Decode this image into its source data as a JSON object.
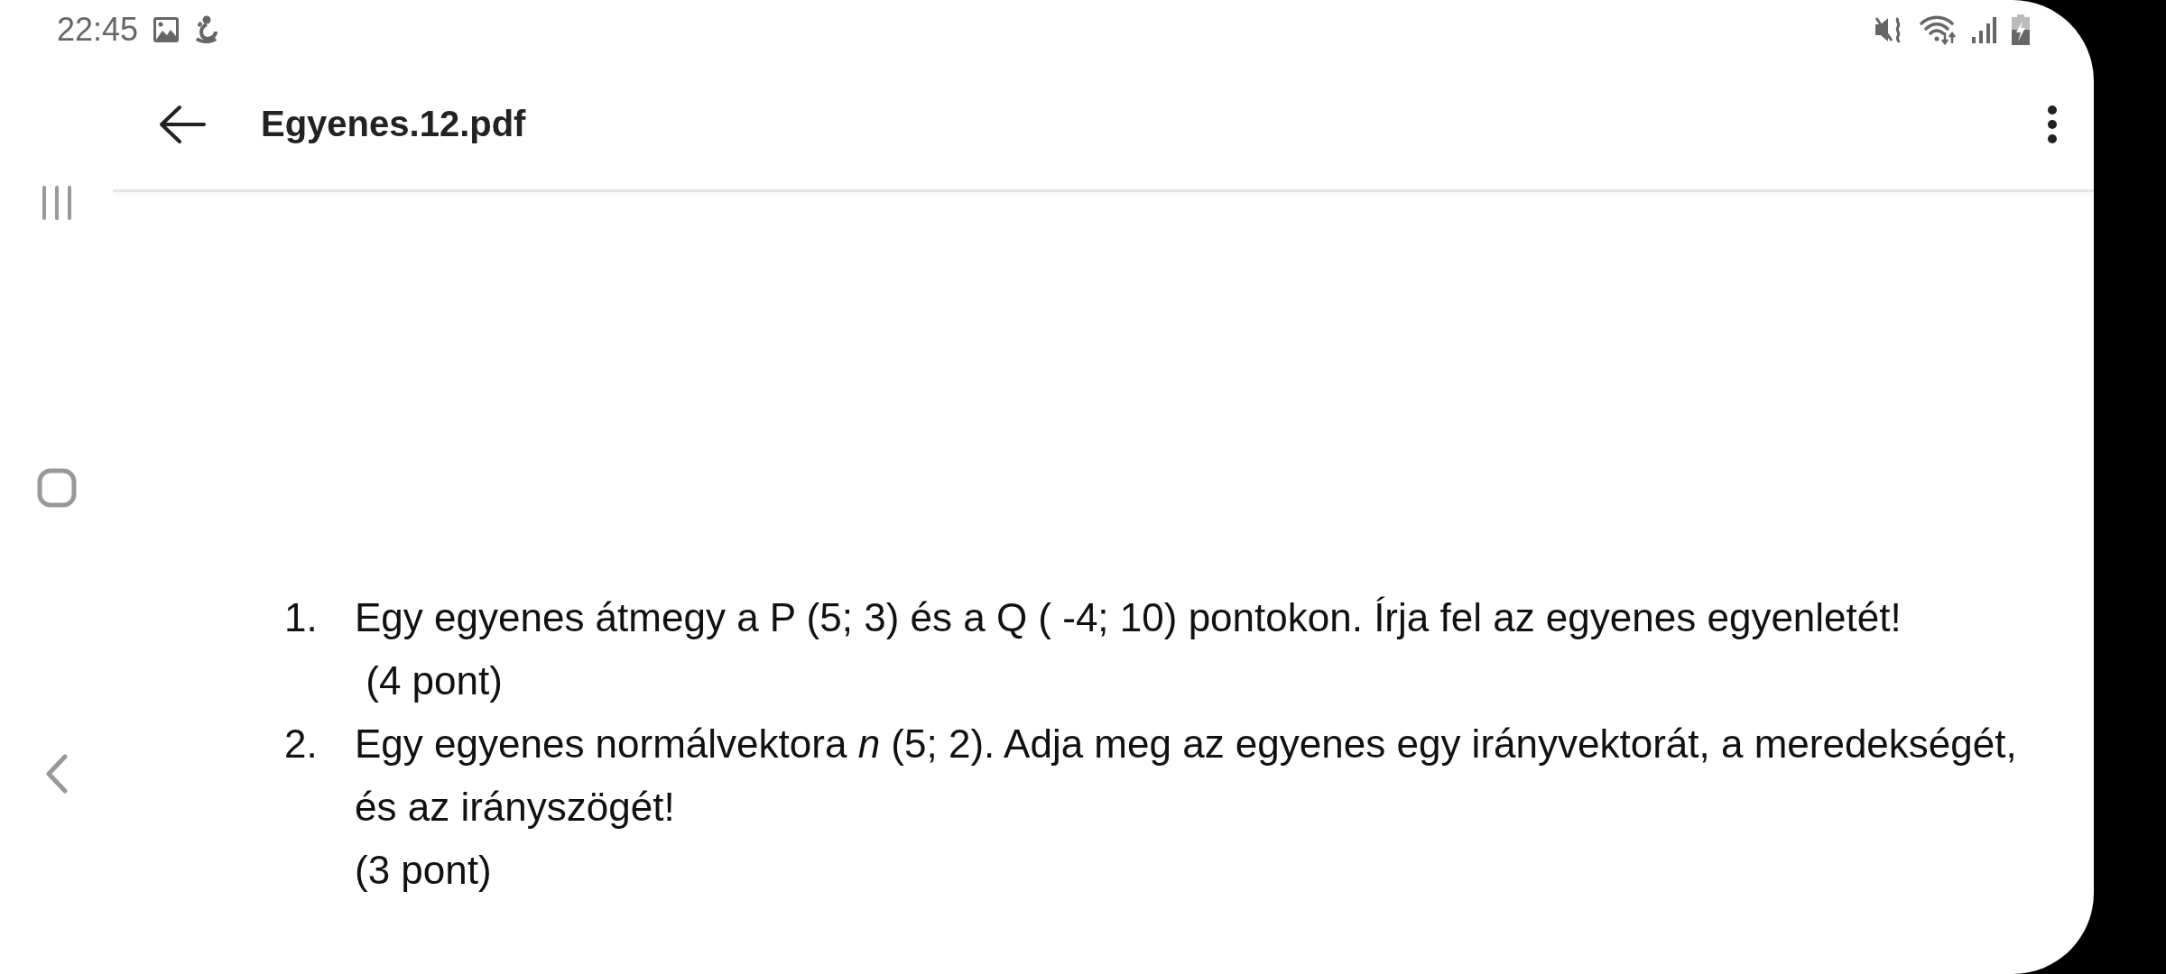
{
  "status_bar": {
    "time": "22:45"
  },
  "app_bar": {
    "title": "Egyenes.12.pdf"
  },
  "document": {
    "items": [
      {
        "number": "1.",
        "text": "Egy egyenes átmegy a P (5; 3) és a Q ( -4; 10) pontokon. Írja fel az egyenes egyenletét!",
        "points": " (4 pont)"
      },
      {
        "number": "2.",
        "text": "Egy egyenes normálvektora *n* (5; 2).  Adja meg az egyenes egy irányvektorát, a meredekségét, és az irányszögét!",
        "points": "(3 pont)"
      }
    ]
  }
}
